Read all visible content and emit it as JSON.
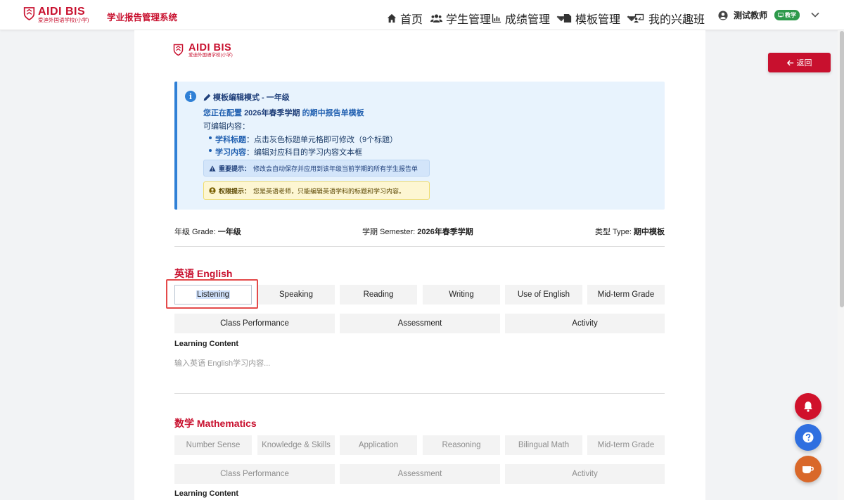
{
  "brand": {
    "name": "AIDI BIS",
    "sub": "爱迪外国语学校(小学)"
  },
  "system_title": "学业报告管理系统",
  "nav": {
    "home": "首页",
    "students": "学生管理",
    "grades": "成绩管理",
    "templates": "模板管理",
    "clubs": "我的兴趣班"
  },
  "user": {
    "name": "测试教师",
    "role": "教学"
  },
  "back_button": "返回",
  "info": {
    "title": "模板编辑模式 - 一年级",
    "config_prefix": "您正在配置",
    "config_term": "2026年春季学期",
    "config_suffix": "的期中报告单模板",
    "editable_heading": "可编辑内容：",
    "items": [
      {
        "key": "学科标题",
        "text": "：点击灰色标题单元格即可修改（9个标题）"
      },
      {
        "key": "学习内容",
        "text": "：编辑对应科目的学习内容文本框"
      }
    ],
    "important_label": "重要提示：",
    "important_text": "修改会自动保存并应用到该年级当前学期的所有学生报告单",
    "permission_label": "权限提示：",
    "permission_text": "您是英语老师，只能编辑英语学科的标题和学习内容。"
  },
  "meta": {
    "grade_label": "年级 Grade:",
    "grade_value": "一年级",
    "semester_label": "学期 Semester:",
    "semester_value": "2026年春季学期",
    "type_label": "类型 Type:",
    "type_value": "期中模板"
  },
  "sections": [
    {
      "title": "英语 English",
      "row1": [
        "Listening",
        "Speaking",
        "Reading",
        "Writing",
        "Use of English",
        "Mid-term Grade"
      ],
      "row2": [
        "Class Performance",
        "Assessment",
        "Activity"
      ],
      "lc_label": "Learning Content",
      "lc_placeholder": "输入英语 English学习内容..."
    },
    {
      "title": "数学 Mathematics",
      "row1": [
        "Number Sense",
        "Knowledge & Skills",
        "Application",
        "Reasoning",
        "Bilingual Math",
        "Mid-term Grade"
      ],
      "row2": [
        "Class Performance",
        "Assessment",
        "Activity"
      ],
      "lc_label": "Learning Content"
    }
  ],
  "colors": {
    "brand_red": "#c8102e",
    "info_blue": "#2f80d6",
    "bell_red": "#d0112b",
    "help_blue": "#2f6fe0",
    "coffee_orange": "#d9682a"
  },
  "icons": [
    "home-icon",
    "users-icon",
    "chart-icon",
    "file-icon",
    "club-icon",
    "user-circle-icon",
    "bell-icon",
    "question-icon",
    "coffee-icon"
  ]
}
